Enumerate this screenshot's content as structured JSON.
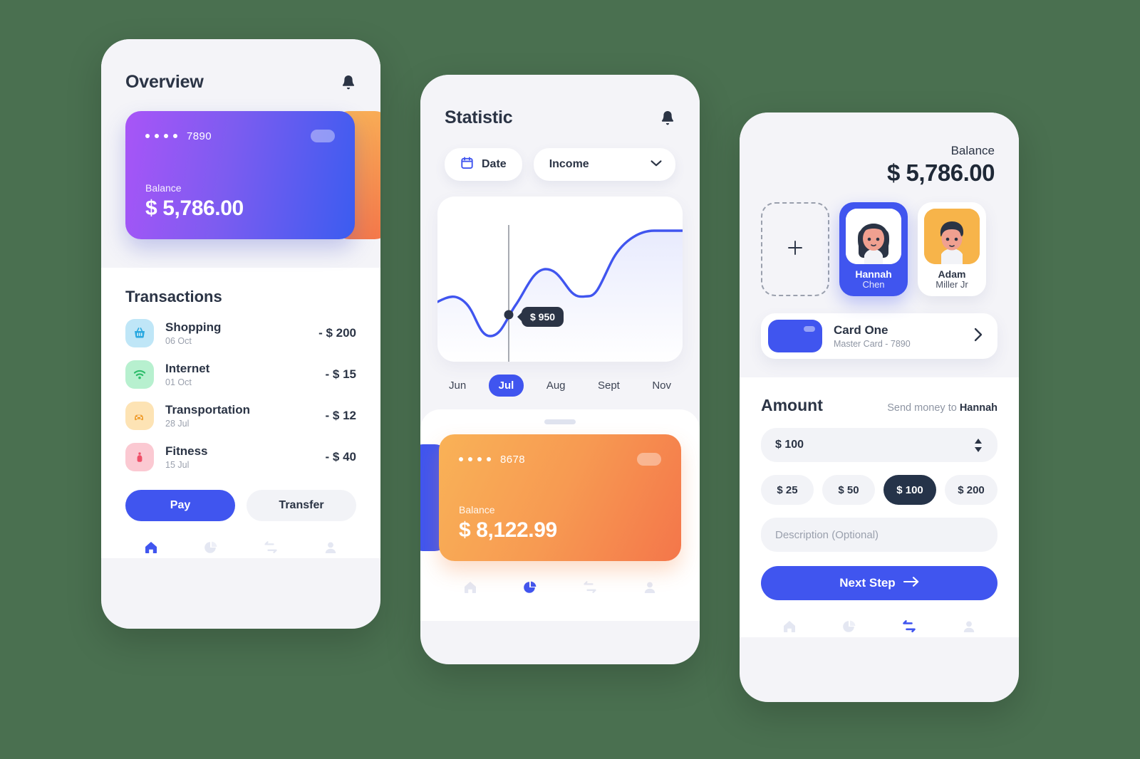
{
  "overview": {
    "title": "Overview",
    "bell_icon": "bell-icon",
    "card": {
      "masked_prefix_dots": 4,
      "last4": "7890",
      "balance_label": "Balance",
      "balance_amount": "$ 5,786.00",
      "gradient_from": "#a855f7",
      "gradient_to": "#3b5cf0"
    },
    "transactions_title": "Transactions",
    "transactions": [
      {
        "name": "Shopping",
        "date": "06 Oct",
        "amount": "- $ 200",
        "icon": "basket-icon",
        "icon_bg": "#bfe6f7",
        "icon_color": "#2aa9e0"
      },
      {
        "name": "Internet",
        "date": "01 Oct",
        "amount": "- $ 15",
        "icon": "wifi-icon",
        "icon_bg": "#b7f0cf",
        "icon_color": "#2ebd6b"
      },
      {
        "name": "Transportation",
        "date": "28 Jul",
        "amount": "- $ 12",
        "icon": "car-icon",
        "icon_bg": "#fde3b4",
        "icon_color": "#f0a132"
      },
      {
        "name": "Fitness",
        "date": "15 Jul",
        "amount": "- $ 40",
        "icon": "dumbbell-icon",
        "icon_bg": "#fbc9d2",
        "icon_color": "#ef4f68"
      }
    ],
    "pay_label": "Pay",
    "transfer_label": "Transfer",
    "nav": [
      {
        "icon": "home-icon",
        "active": true
      },
      {
        "icon": "pie-icon",
        "active": false
      },
      {
        "icon": "exchange-icon",
        "active": false
      },
      {
        "icon": "person-icon",
        "active": false
      }
    ]
  },
  "statistic": {
    "title": "Statistic",
    "bell_icon": "bell-icon",
    "date_filter_label": "Date",
    "date_filter_icon": "calendar-icon",
    "income_filter_label": "Income",
    "income_filter_icon": "chevron-down-icon",
    "tooltip_value": "$ 950",
    "months": [
      {
        "label": "Jun",
        "active": false
      },
      {
        "label": "Jul",
        "active": true
      },
      {
        "label": "Aug",
        "active": false
      },
      {
        "label": "Sept",
        "active": false
      },
      {
        "label": "Nov",
        "active": false
      }
    ],
    "card": {
      "last4": "8678",
      "balance_label": "Balance",
      "balance_amount": "$ 8,122.99",
      "gradient_from": "#f9b257",
      "gradient_to": "#f4764a"
    },
    "nav": [
      {
        "icon": "home-icon",
        "active": false
      },
      {
        "icon": "pie-icon",
        "active": true
      },
      {
        "icon": "exchange-icon",
        "active": false
      },
      {
        "icon": "person-icon",
        "active": false
      }
    ]
  },
  "chart_data": {
    "type": "line",
    "title": "",
    "xlabel": "",
    "ylabel": "",
    "categories": [
      "Jun",
      "Jul",
      "Aug",
      "Sept",
      "Nov"
    ],
    "x": [
      0,
      12,
      24,
      36,
      48,
      60,
      72,
      84,
      100
    ],
    "values": [
      560,
      520,
      300,
      950,
      1180,
      1080,
      820,
      1380,
      1420
    ],
    "highlight": {
      "x_index": 3,
      "label": "$ 950",
      "value": 950
    },
    "legend": [],
    "grid": false,
    "area_fill": true,
    "line_color": "#4055ef",
    "ylim": [
      0,
      1600
    ]
  },
  "transfer": {
    "balance_label": "Balance",
    "balance_amount": "$ 5,786.00",
    "add_person_icon": "plus-icon",
    "people": [
      {
        "first": "Hannah",
        "last": "Chen",
        "selected": true,
        "avatar_bg": "#ffffff"
      },
      {
        "first": "Adam",
        "last": "Miller Jr",
        "selected": false,
        "avatar_bg": "#f7b44a"
      }
    ],
    "card_select": {
      "name": "Card One",
      "subtitle": "Master Card - 7890",
      "chevron_icon": "chevron-right-icon"
    },
    "amount_title": "Amount",
    "send_to_prefix": "Send money to ",
    "send_to_name": "Hannah",
    "amount_value": "$ 100",
    "stepper_icon": "stepper-updown-icon",
    "amount_chips": [
      {
        "label": "$ 25",
        "active": false
      },
      {
        "label": "$ 50",
        "active": false
      },
      {
        "label": "$ 100",
        "active": true
      },
      {
        "label": "$ 200",
        "active": false
      }
    ],
    "description_placeholder": "Description (Optional)",
    "description_value": "",
    "next_label": "Next Step",
    "next_icon": "arrow-right-icon",
    "nav": [
      {
        "icon": "home-icon",
        "active": false
      },
      {
        "icon": "pie-icon",
        "active": false
      },
      {
        "icon": "exchange-icon",
        "active": true
      },
      {
        "icon": "person-icon",
        "active": false
      }
    ]
  }
}
